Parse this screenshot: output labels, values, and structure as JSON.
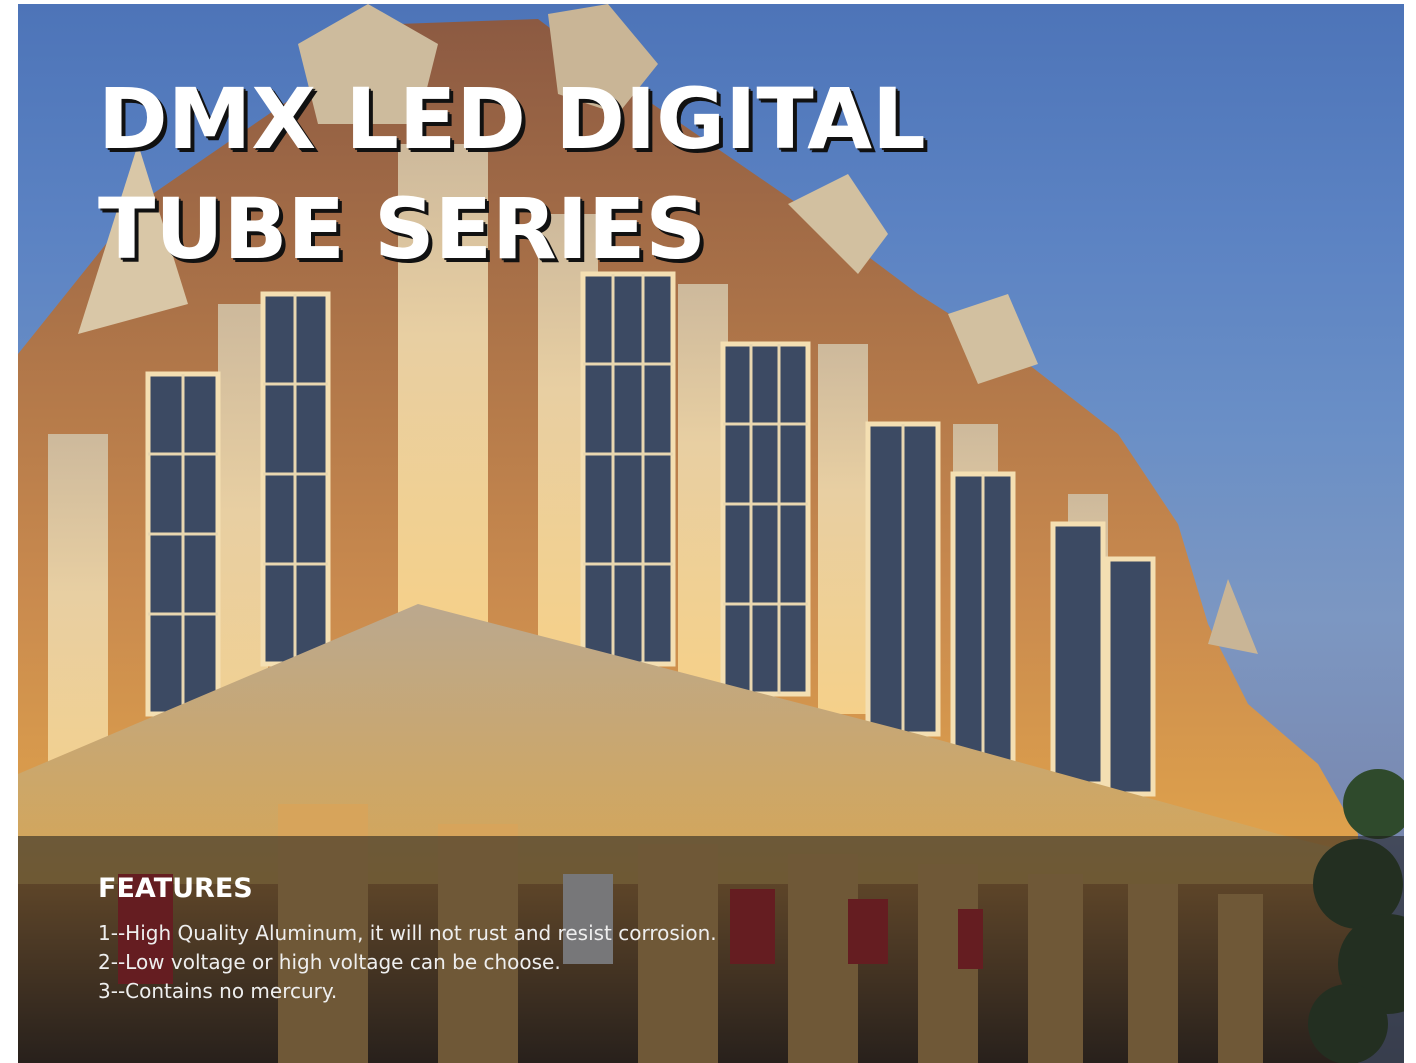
{
  "hero": {
    "title": "DMX LED DIGITAL TUBE SERIES",
    "image_description": "building-facade-photo"
  },
  "features": {
    "title": "FEATURES",
    "items": [
      "1--High Quality Aluminum, it will not rust and resist corrosion.",
      "2--Low voltage or high voltage can be choose.",
      "3--Contains no mercury."
    ]
  }
}
